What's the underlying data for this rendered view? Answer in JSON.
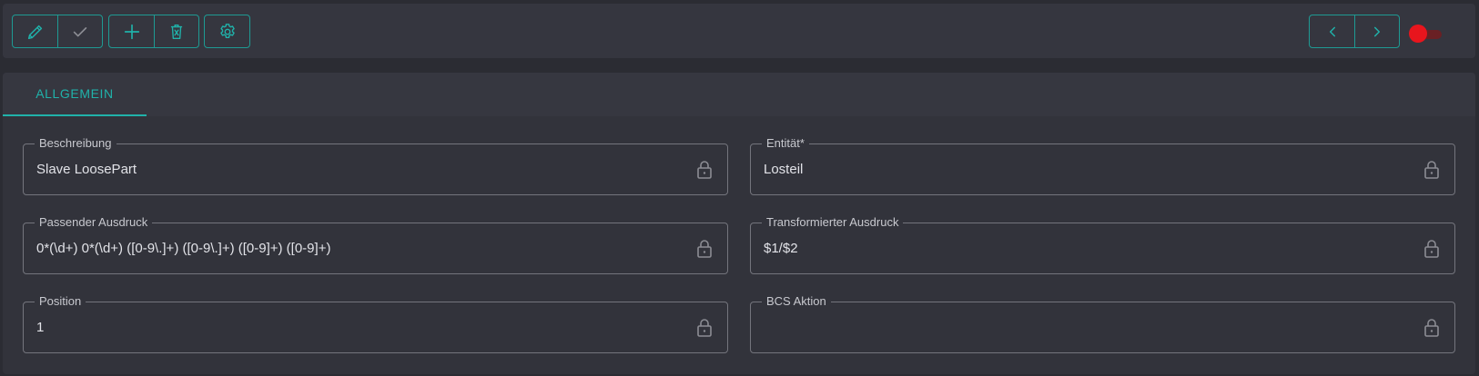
{
  "toolbar": {
    "buttons": {
      "edit": "pencil-icon",
      "confirm": "check-icon",
      "add": "plus-icon",
      "delete": "trash-icon",
      "settings": "gear-icon",
      "previous": "chevron-left-icon",
      "next": "chevron-right-icon"
    },
    "toggle_on": false
  },
  "tabs": [
    {
      "label": "ALLGEMEIN",
      "active": true
    }
  ],
  "fields": {
    "beschreibung": {
      "label": "Beschreibung",
      "value": "Slave LoosePart"
    },
    "entitaet": {
      "label": "Entität*",
      "value": "Losteil"
    },
    "passender_ausdruck": {
      "label": "Passender Ausdruck",
      "value": "0*(\\d+) 0*(\\d+) ([0-9\\.]+) ([0-9\\.]+) ([0-9]+) ([0-9]+)"
    },
    "transformierter_ausdruck": {
      "label": "Transformierter Ausdruck",
      "value": "$1/$2"
    },
    "position": {
      "label": "Position",
      "value": "1"
    },
    "bcs_aktion": {
      "label": "BCS Aktion",
      "value": ""
    }
  },
  "colors": {
    "accent": "#20b2aa",
    "toggle_knob": "#e8151d",
    "background": "#2b2c33",
    "panel": "#32333b"
  }
}
